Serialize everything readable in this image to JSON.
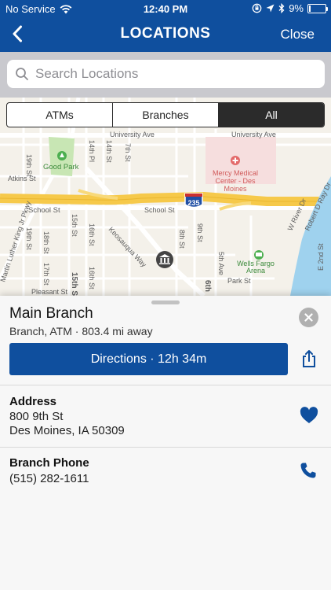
{
  "status": {
    "carrier": "No Service",
    "time": "12:40 PM",
    "battery": "9%",
    "battery_level": 0.09
  },
  "nav": {
    "back_icon": "chevron-left-icon",
    "title": "LOCATIONS",
    "close_label": "Close"
  },
  "search": {
    "placeholder": "Search Locations",
    "value": ""
  },
  "filters": {
    "items": [
      "ATMs",
      "Branches",
      "All"
    ],
    "selected": "All"
  },
  "map": {
    "labels": {
      "good_park": "Good Park",
      "university_ave_left": "University Ave",
      "university_ave_right": "University Ave",
      "mercy": [
        "Mercy Medical",
        "Center - Des",
        "Moines"
      ],
      "atkins": "Atkins St",
      "school_st_left": "School St",
      "school_st_right": "School St",
      "interstate": "235",
      "keosauqua": "Keosauqua Way",
      "wells_fargo": [
        "Wells Fargo",
        "Arena"
      ],
      "park_st": "Park St",
      "pleasant": "Pleasant St",
      "st19_top": "19th St",
      "st19_bottom": "19th St",
      "st15": "15th St",
      "pl14": "14th Pl",
      "st14": "14th St",
      "st8": "8th St",
      "ave5": "5th Ave",
      "st6": "6th",
      "mlk": "Martin Luther King Jr Pkwy",
      "river_dr": "W River Dr",
      "robert_ray": "Robert D Ray Dr",
      "e2nd": "E 2nd St",
      "st15_mid": "15th St",
      "st16": "16th St",
      "st18": "18th St",
      "st17": "17th St",
      "st16b": "16th St",
      "st9": "9th St",
      "st7": "7th St"
    },
    "colors": {
      "land": "#f4f1ea",
      "freeway": "#f6c94a",
      "water": "#9fd2ee",
      "park": "#c8e6b4",
      "hospital": "#f6dede"
    }
  },
  "branch": {
    "name": "Main Branch",
    "subtitle": "Branch, ATM · 803.4 mi away",
    "directions_label": "Directions · 12h 34m",
    "address_label": "Address",
    "address_line1": "800 9th St",
    "address_line2": "Des Moines, IA  50309",
    "phone_label": "Branch Phone",
    "phone": "(515) 282-1611"
  },
  "colors": {
    "brand": "#0f4f9e",
    "segment_active": "#2b2b2b"
  }
}
